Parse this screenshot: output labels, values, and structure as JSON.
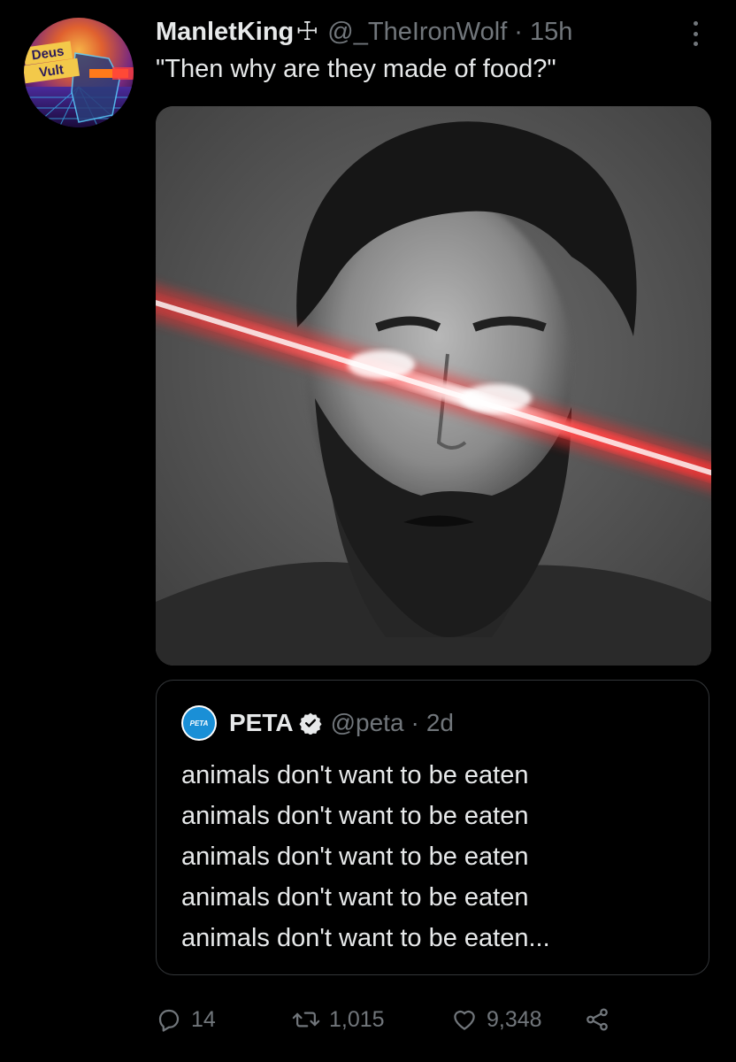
{
  "tweet": {
    "display_name": "ManletKing",
    "name_symbol": "☩",
    "handle": "@_TheIronWolf",
    "separator": "·",
    "time": "15h",
    "text": "\"Then why are they made of food?\"",
    "avatar_text_top": "Deus",
    "avatar_text_bottom": "Vult"
  },
  "quote": {
    "avatar_text": "PETA",
    "display_name": "PETA",
    "handle": "@peta",
    "separator": "·",
    "time": "2d",
    "lines": [
      "animals don't want to be eaten",
      "animals don't want to be eaten",
      "animals don't want to be eaten",
      "animals don't want to be eaten",
      "animals don't want to be eaten..."
    ]
  },
  "actions": {
    "replies": "14",
    "retweets": "1,015",
    "likes": "9,348"
  },
  "colors": {
    "background": "#000000",
    "text": "#e7e9ea",
    "secondary_text": "#71767b",
    "border": "#333639",
    "verified": "#1d9bf0",
    "laser": "#ff2a2a"
  },
  "icons": [
    "more-icon",
    "verified-icon",
    "reply-icon",
    "retweet-icon",
    "like-icon",
    "share-icon"
  ]
}
